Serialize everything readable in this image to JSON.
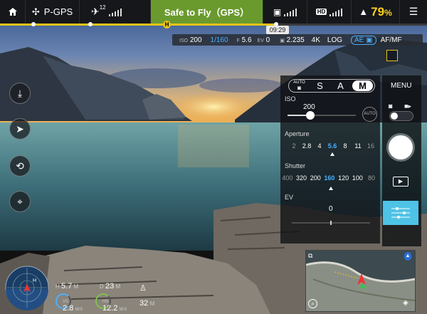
{
  "topbar": {
    "home_icon": "home-icon",
    "drone_icon": "drone-icon",
    "mode": "P-GPS",
    "satellite_icon": "satellite-icon",
    "satellite_count": "12",
    "status": "Safe to Fly（GPS）",
    "status_color": "#6a9a2e",
    "rc_icon": "remote-controller-icon",
    "hd_label": "HD",
    "battery_icon": "battery-icon",
    "battery_percent": "79",
    "battery_unit": "%",
    "battery_color": "#ffd21f",
    "menu_icon": "menu-icon"
  },
  "timeline": {
    "home_marker": "H",
    "time": "09:29",
    "progress": 0.65
  },
  "camera_params": {
    "iso_label": "ISO",
    "iso": "200",
    "shutter": "1/160",
    "aperture_label": "F",
    "aperture": "5.6",
    "ev_label": "EV",
    "ev": "0",
    "storage": "2.235",
    "resolution": "4K",
    "color": "LOG",
    "ae_lock": "AE",
    "focus": "AF/MF"
  },
  "left_tools": [
    {
      "name": "takeoff-icon",
      "glyph": "⤓"
    },
    {
      "name": "navigation-icon",
      "glyph": "➤"
    },
    {
      "name": "intelligent-flight-icon",
      "glyph": "⟲"
    },
    {
      "name": "waypoint-icon",
      "glyph": "⌖"
    }
  ],
  "exposure": {
    "auto_label": "AUTO",
    "modes": [
      "S",
      "A",
      "M"
    ],
    "active_mode": "M",
    "iso_title": "ISO",
    "iso_value": "200",
    "iso_auto": "AUTO",
    "iso_slider": 0.33,
    "aperture_title": "Aperture",
    "aperture_values": [
      "2",
      "2.8",
      "4",
      "5.6",
      "8",
      "11",
      "16"
    ],
    "aperture_selected": "5.6",
    "shutter_title": "Shutter",
    "shutter_values": [
      "400",
      "320",
      "200",
      "160",
      "120",
      "100",
      "80"
    ],
    "shutter_selected": "160",
    "ev_title": "EV",
    "ev_value": "0"
  },
  "right_column": {
    "menu_label": "MENU",
    "photo_icon": "camera-icon",
    "video_icon": "video-icon",
    "playback_icon": "play-icon",
    "settings_icon": "camera-settings-icon",
    "accent": "#4ec3e6"
  },
  "telemetry": {
    "h_label": "H",
    "h_value": "5.7",
    "h_unit": "M",
    "d_label": "D",
    "d_value": "23",
    "d_unit": "M",
    "vs_label": "VS",
    "vs_value": "2.8",
    "vs_unit": "M/S",
    "hs_label": "HS",
    "hs_value": "12.2",
    "hs_unit": "M/S",
    "alt_value": "32",
    "alt_unit": "M"
  },
  "minimap": {
    "zoom_icon": "zoom-icon",
    "expand_icon": "expand-icon",
    "compass_icon": "compass-icon",
    "eraser_icon": "eraser-icon"
  }
}
